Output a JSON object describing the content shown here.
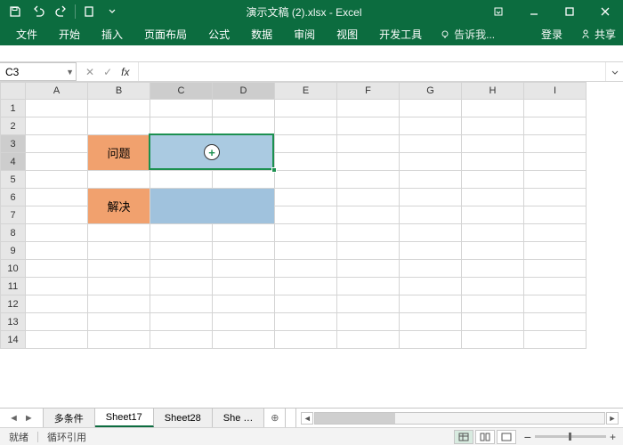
{
  "title": "演示文稿 (2).xlsx - Excel",
  "tabs": [
    "文件",
    "开始",
    "插入",
    "页面布局",
    "公式",
    "数据",
    "审阅",
    "视图",
    "开发工具"
  ],
  "tell_me": "告诉我...",
  "login": "登录",
  "share": "共享",
  "namebox": "C3",
  "columns": [
    "A",
    "B",
    "C",
    "D",
    "E",
    "F",
    "G",
    "H",
    "I"
  ],
  "row_count": 14,
  "cells": {
    "B3": "问题",
    "B6": "解决"
  },
  "sheets": {
    "items": [
      "多条件",
      "Sheet17",
      "Sheet28",
      "She …"
    ],
    "active": 1
  },
  "status": {
    "ready": "就绪",
    "circ": "循环引用"
  },
  "zoom": {
    "minus": "−",
    "plus": "+",
    "value": ""
  }
}
